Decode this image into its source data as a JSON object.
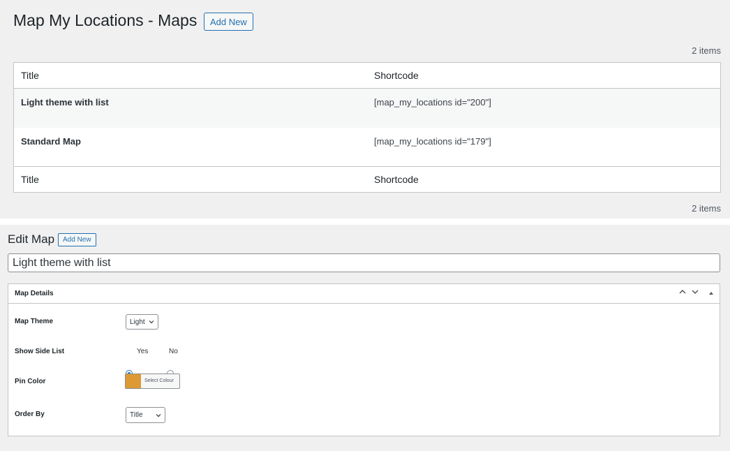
{
  "list_page": {
    "title": "Map My Locations - Maps",
    "add_new_label": "Add New",
    "items_count_top": "2 items",
    "items_count_bottom": "2 items",
    "columns": [
      "Title",
      "Shortcode"
    ],
    "rows": [
      {
        "title": "Light theme with list",
        "shortcode": "[map_my_locations id=\"200\"]"
      },
      {
        "title": "Standard Map",
        "shortcode": "[map_my_locations id=\"179\"]"
      }
    ]
  },
  "edit_page": {
    "title": "Edit Map",
    "add_new_label": "Add New",
    "map_title_value": "Light theme with list",
    "box_title": "Map Details",
    "fields": {
      "theme_label": "Map Theme",
      "theme_value": "Light",
      "side_list_label": "Show Side List",
      "side_list_yes": "Yes",
      "side_list_no": "No",
      "side_list_selected": "Yes",
      "pin_color_label": "Pin Color",
      "pin_color_button": "Select Colour",
      "pin_color_value": "#dd9933",
      "order_by_label": "Order By",
      "order_by_value": "Title"
    }
  },
  "colors": {
    "accent": "#2271b1",
    "background": "#f0f0f1"
  },
  "icons": {
    "move_up": "chevron-up-icon",
    "move_down": "chevron-down-icon",
    "toggle": "triangle-up-icon",
    "select_arrow": "chevron-down-icon"
  }
}
